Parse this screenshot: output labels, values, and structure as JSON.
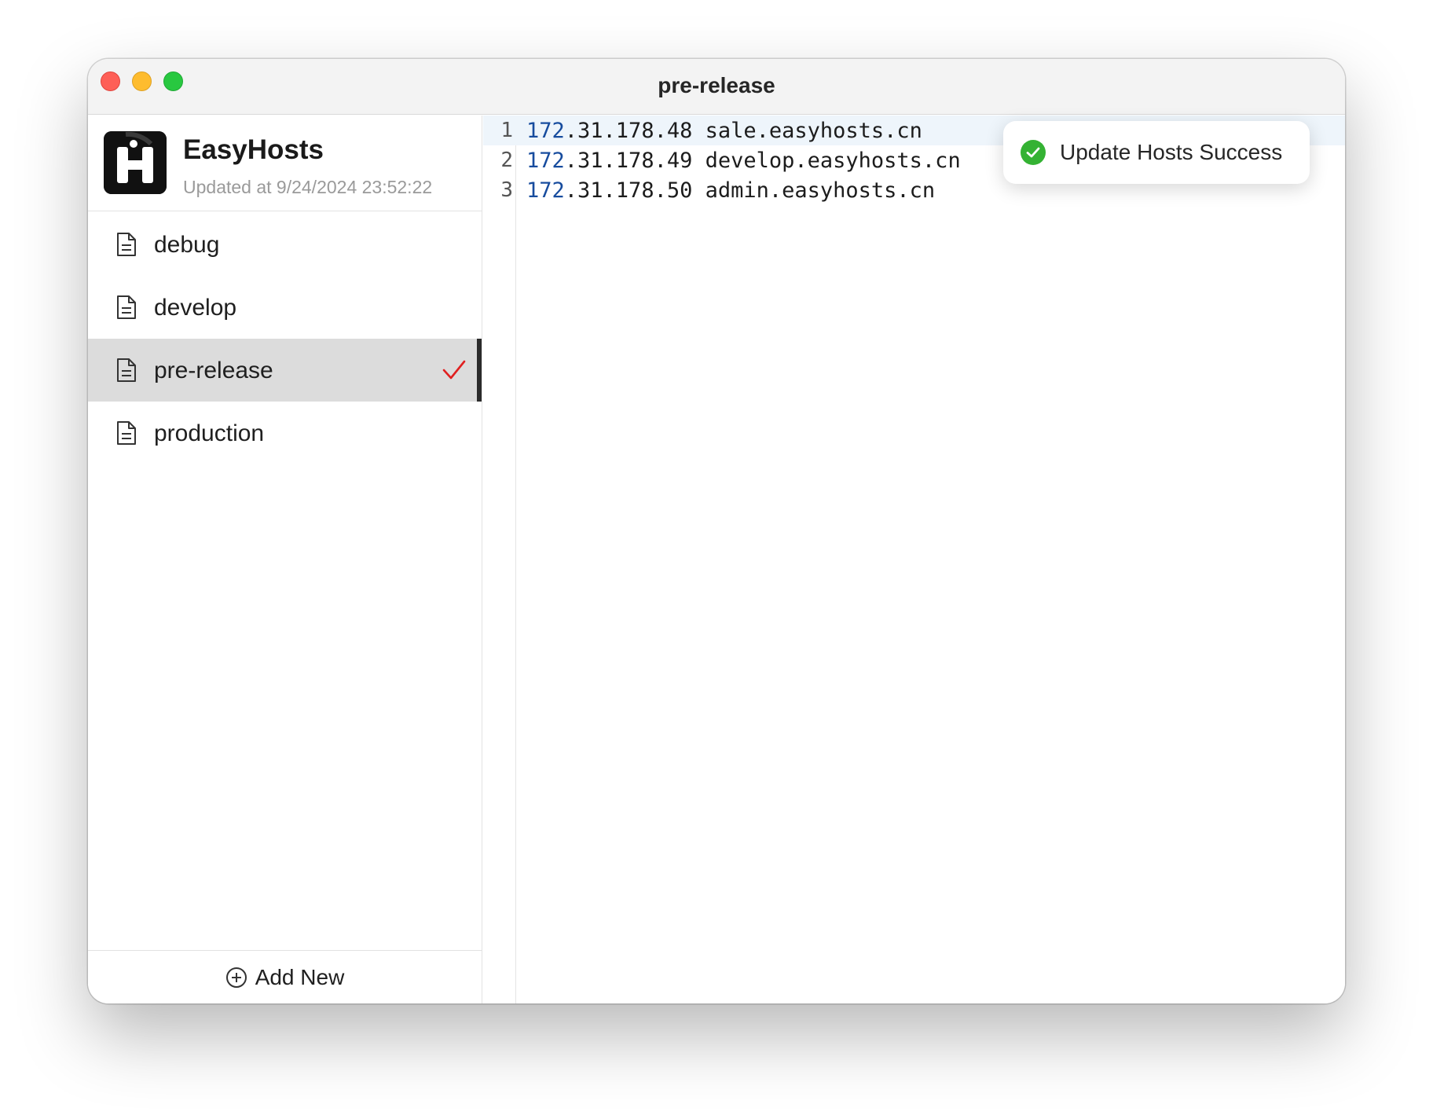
{
  "window": {
    "title": "pre-release"
  },
  "brand": {
    "name": "EasyHosts",
    "updated": "Updated at 9/24/2024 23:52:22",
    "logo_letter": "H"
  },
  "files": [
    {
      "label": "debug",
      "icon": "document-icon",
      "active": false
    },
    {
      "label": "develop",
      "icon": "document-icon",
      "active": false
    },
    {
      "label": "pre-release",
      "icon": "document-icon",
      "active": true,
      "status_icon": "checkmark-icon"
    },
    {
      "label": "production",
      "icon": "document-icon",
      "active": false
    }
  ],
  "add_new": {
    "label": "Add New",
    "icon": "plus-circle-icon"
  },
  "editor": {
    "lines": [
      {
        "number": "1",
        "ip_head": "172",
        "rest": ".31.178.48 sale.easyhosts.cn"
      },
      {
        "number": "2",
        "ip_head": "172",
        "rest": ".31.178.49 develop.easyhosts.cn"
      },
      {
        "number": "3",
        "ip_head": "172",
        "rest": ".31.178.50 admin.easyhosts.cn"
      }
    ]
  },
  "toast": {
    "message": "Update Hosts Success",
    "icon": "success-check-icon"
  },
  "colors": {
    "traffic_red": "#fe5f57",
    "traffic_yellow": "#febc2e",
    "traffic_green": "#28c840",
    "active_check": "#e02020",
    "success": "#34b233",
    "ip_head": "#174c9e"
  }
}
